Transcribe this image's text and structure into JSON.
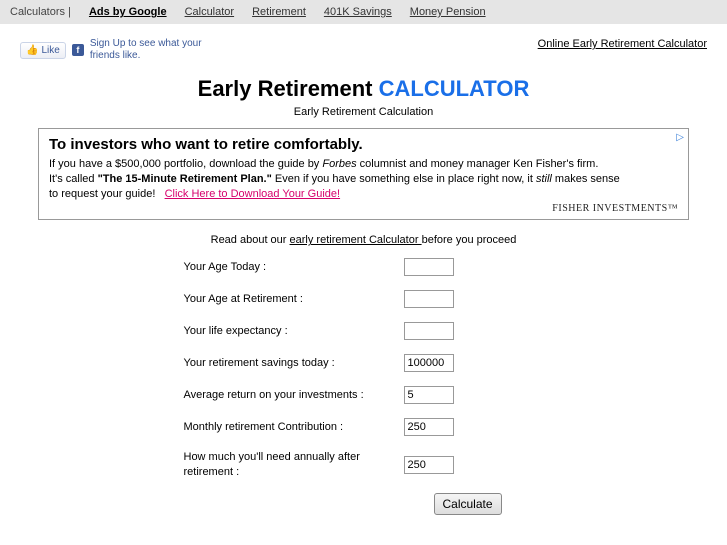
{
  "topbar": {
    "label": "Calculators |",
    "ads_by_google": "Ads by Google",
    "links": [
      "Calculator",
      "Retirement",
      "401K Savings",
      "Money Pension"
    ]
  },
  "social": {
    "like_label": "Like",
    "signup_text": "Sign Up",
    "signup_rest": " to see what your friends like.",
    "online_link": "Online Early Retirement Calculator"
  },
  "title": {
    "part1": "Early Retirement ",
    "part2": "CALCULATOR"
  },
  "subtitle": "Early Retirement Calculation",
  "ad": {
    "headline": "To investors who want to retire comfortably.",
    "line1_a": "If you have a $500,000 portfolio, download the guide by ",
    "line1_forbes": "Forbes",
    "line1_b": " columnist and money manager Ken Fisher's firm.",
    "line2_a": "It's called ",
    "line2_bold": "\"The 15-Minute Retirement Plan.\"",
    "line2_b": " Even if you have something else in place right now, it ",
    "line2_still": "still",
    "line2_c": " makes sense",
    "line3_a": "to request your guide!",
    "cta": "Click Here to Download Your Guide!",
    "brand": "FISHER INVESTMENTS™",
    "adchoices": "▷"
  },
  "intro": {
    "a": "Read about our ",
    "u": "early retirement Calculator ",
    "b": "before you proceed"
  },
  "form": {
    "fields": [
      {
        "label": "Your Age Today :",
        "value": ""
      },
      {
        "label": "Your Age at Retirement :",
        "value": ""
      },
      {
        "label": "Your life expectancy :",
        "value": ""
      },
      {
        "label": "Your retirement savings today :",
        "value": "100000"
      },
      {
        "label": "Average return on your investments :",
        "value": "5"
      },
      {
        "label": "Monthly retirement Contribution :",
        "value": "250"
      },
      {
        "label": "How much you'll need annually after retirement :",
        "value": "250"
      }
    ],
    "submit": "Calculate"
  }
}
